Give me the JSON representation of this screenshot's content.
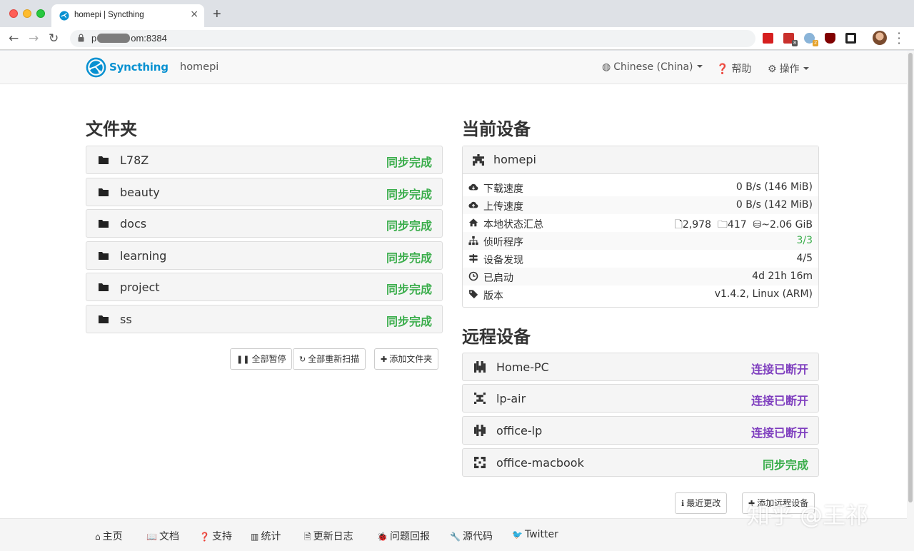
{
  "browser": {
    "tab_title": "homepi | Syncthing",
    "tab_close": "×",
    "new_tab": "+",
    "url_prefix": "p",
    "url_suffix": "om:8384",
    "star": "☆",
    "ext_badge_1": "8",
    "ext_badge_2": "2"
  },
  "navbar": {
    "brand": "Syncthing",
    "hostname": "homepi",
    "language": "Chinese (China)",
    "help": "帮助",
    "actions": "操作"
  },
  "folders": {
    "heading": "文件夹",
    "items": [
      {
        "name": "L78Z",
        "status": "同步完成"
      },
      {
        "name": "beauty",
        "status": "同步完成"
      },
      {
        "name": "docs",
        "status": "同步完成"
      },
      {
        "name": "learning",
        "status": "同步完成"
      },
      {
        "name": "project",
        "status": "同步完成"
      },
      {
        "name": "ss",
        "status": "同步完成"
      }
    ],
    "pause_all": "全部暂停",
    "rescan_all": "全部重新扫描",
    "add_folder": "添加文件夹"
  },
  "this_device": {
    "heading": "当前设备",
    "name": "homepi",
    "rows": [
      {
        "label": "下载速度",
        "value": "0 B/s (146 MiB)"
      },
      {
        "label": "上传速度",
        "value": "0 B/s (142 MiB)"
      },
      {
        "label": "本地状态汇总",
        "files": "2,978",
        "dirs": "417",
        "size": "~2.06 GiB"
      },
      {
        "label": "侦听程序",
        "value": "3/3"
      },
      {
        "label": "设备发现",
        "value": "4/5"
      },
      {
        "label": "已启动",
        "value": "4d 21h 16m"
      },
      {
        "label": "版本",
        "value": "v1.4.2, Linux (ARM)"
      }
    ]
  },
  "remote_devices": {
    "heading": "远程设备",
    "items": [
      {
        "name": "Home-PC",
        "status": "连接已断开"
      },
      {
        "name": "lp-air",
        "status": "连接已断开"
      },
      {
        "name": "office-lp",
        "status": "连接已断开"
      },
      {
        "name": "office-macbook",
        "status": "同步完成"
      }
    ],
    "recent_changes": "最近更改",
    "add_remote": "添加远程设备"
  },
  "footer": {
    "home": "主页",
    "docs": "文档",
    "support": "支持",
    "stats": "统计",
    "changelog": "更新日志",
    "bugs": "问题回报",
    "source": "源代码",
    "twitter": "Twitter"
  },
  "watermark": "知乎 @王祁",
  "colors": {
    "in_sync": "#3cae4d",
    "disconnected": "#7f3fbf",
    "brand": "#0891d1"
  }
}
